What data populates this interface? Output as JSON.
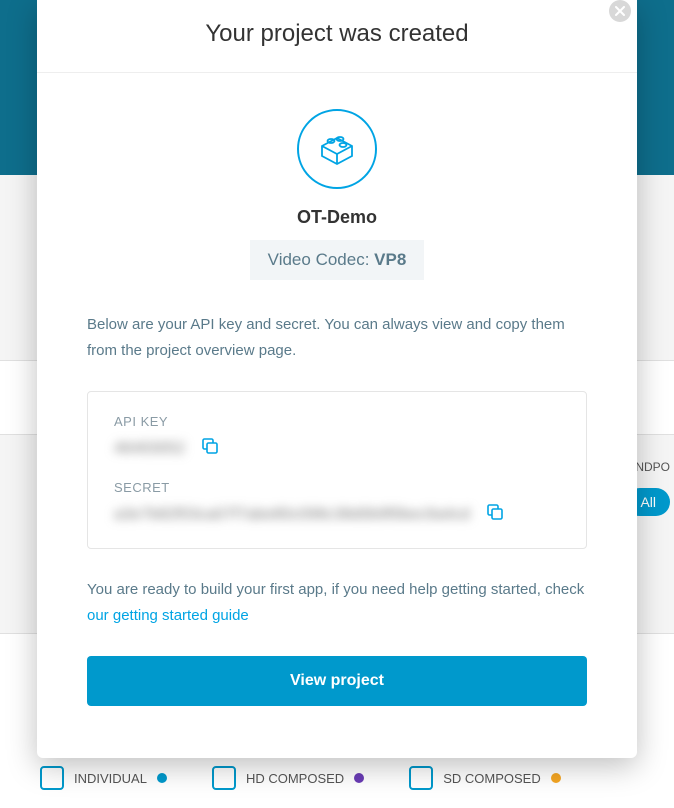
{
  "modal": {
    "title": "Your project was created",
    "project_name": "OT-Demo",
    "codec_label": "Video Codec:",
    "codec_value": "VP8",
    "intro": "Below are your API key and secret. You can always view and copy them from the project overview page.",
    "api_key_label": "API KEY",
    "api_key_value": "46493052",
    "secret_label": "SECRET",
    "secret_value": "a3e7b82f03ca07f7abe80c098c38d0b9f0bec9a4cd",
    "ready_text_1": "You are ready to build your first app, if you need help getting started, check ",
    "guide_link": "our getting started guide",
    "view_button": "View project"
  },
  "backdrop": {
    "endpoint_label": "NDPO",
    "all_label": "All",
    "footer": [
      {
        "label": "INDIVIDUAL",
        "dot": "blue"
      },
      {
        "label": "HD COMPOSED",
        "dot": "purple"
      },
      {
        "label": "SD COMPOSED",
        "dot": "orange"
      }
    ]
  }
}
